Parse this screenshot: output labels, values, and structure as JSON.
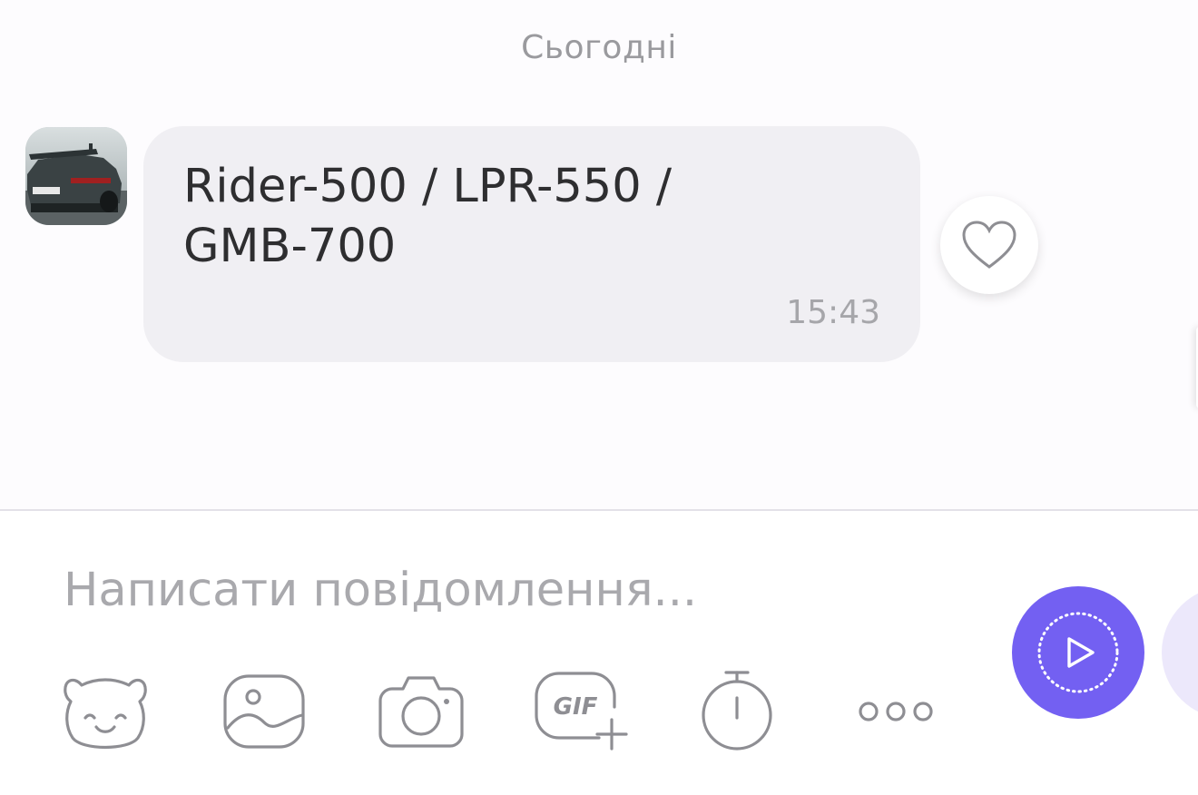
{
  "chat": {
    "date_divider": "Сьогодні",
    "messages": [
      {
        "text": "Rider-500 / LPR-550 / GMB-700",
        "time": "15:43",
        "avatar_icon": "sports-car-avatar",
        "reaction_icon": "heart-icon"
      }
    ]
  },
  "composer": {
    "placeholder": "Написати повідомлення...",
    "value": "",
    "toolbar": [
      {
        "icon": "sticker-bear-icon"
      },
      {
        "icon": "gallery-icon"
      },
      {
        "icon": "camera-icon"
      },
      {
        "icon": "gif-plus-icon",
        "label": "GIF"
      },
      {
        "icon": "timer-icon"
      },
      {
        "icon": "more-dots-icon"
      }
    ],
    "send_icon": "video-message-icon"
  },
  "colors": {
    "accent": "#7360f2",
    "bubble": "#f0eff3",
    "background": "#fdfcfe",
    "icon_stroke": "#8e8e93",
    "muted_text": "#9a9a9e"
  }
}
